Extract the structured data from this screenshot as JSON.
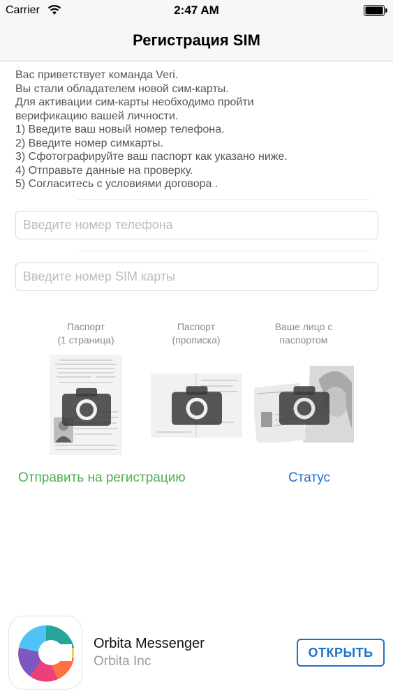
{
  "status_bar": {
    "carrier": "Carrier",
    "time": "2:47 AM"
  },
  "nav": {
    "title": "Регистрация SIM"
  },
  "intro_lines": [
    "Вас приветствует команда Veri.",
    "Вы стали обладателем новой сим-карты.",
    "Для активации сим-карты необходимо пройти",
    "верификацию вашей личности.",
    "1) Введите ваш новый номер телефона.",
    "2) Введите номер симкарты.",
    "3) Сфотографируйте ваш паспорт как указано ниже.",
    "4) Отправьте данные на проверку.",
    "5) Согласитесь с условиями договора ."
  ],
  "form": {
    "phone_placeholder": "Введите номер телефона",
    "sim_placeholder": "Введите номер SIM карты"
  },
  "photos": [
    {
      "label_line1": "Паспорт",
      "label_line2": "(1 страница)",
      "icon": "camera-icon"
    },
    {
      "label_line1": "Паспорт",
      "label_line2": "(прописка)",
      "icon": "camera-icon"
    },
    {
      "label_line1": "Ваше лицо с",
      "label_line2": "паспортом",
      "icon": "camera-icon"
    }
  ],
  "actions": {
    "submit_label": "Отправить на регистрацию",
    "status_label": "Статус"
  },
  "banner": {
    "app_name": "Orbita Messenger",
    "vendor": "Orbita Inc",
    "open_label": "ОТКРЫТЬ"
  },
  "colors": {
    "green_link": "#4caf50",
    "blue_link": "#1a73c9",
    "label_gray": "#8a8a8a"
  }
}
